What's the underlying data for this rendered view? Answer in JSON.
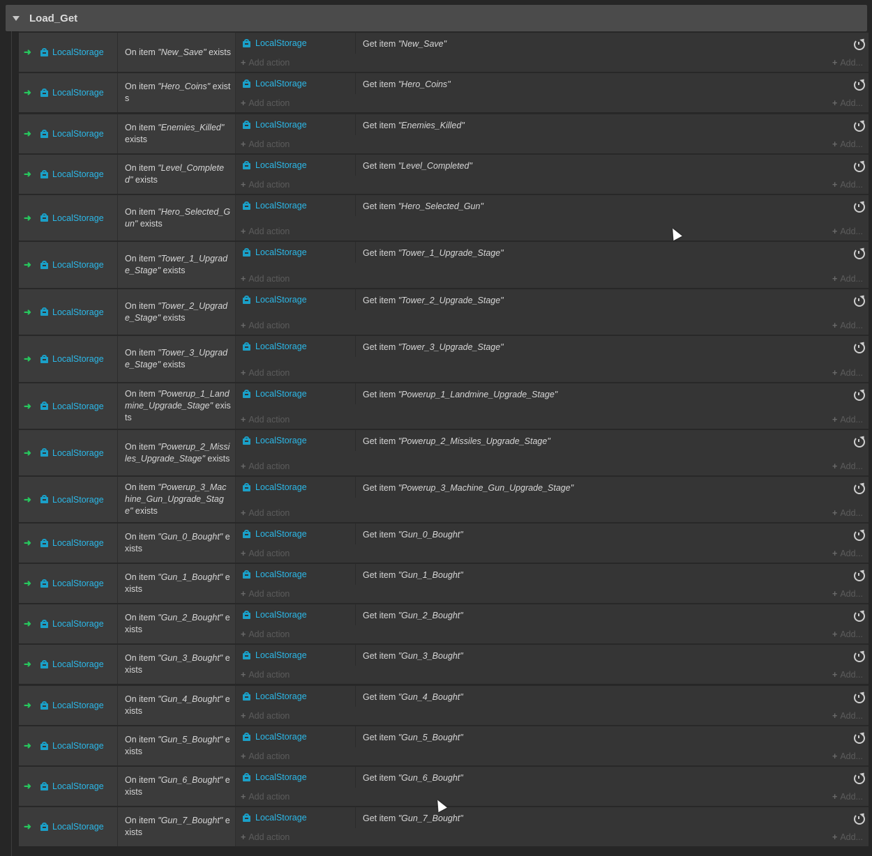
{
  "group": {
    "title": "Load_Get"
  },
  "common": {
    "object_name": "LocalStorage",
    "add_action": "Add action",
    "add_more": "Add...",
    "condition_prefix": "On item",
    "condition_suffix": "exists",
    "action_prefix": "Get item",
    "icons": {
      "trigger": "green-arrow-icon",
      "object": "local-storage-icon",
      "refresh": "refresh-icon",
      "expand": "triangle-down-icon"
    }
  },
  "rows": [
    {
      "item": "New_Save"
    },
    {
      "item": "Hero_Coins"
    },
    {
      "item": "Enemies_Killed"
    },
    {
      "item": "Level_Completed"
    },
    {
      "item": "Hero_Selected_Gun"
    },
    {
      "item": "Tower_1_Upgrade_Stage"
    },
    {
      "item": "Tower_2_Upgrade_Stage"
    },
    {
      "item": "Tower_3_Upgrade_Stage"
    },
    {
      "item": "Powerup_1_Landmine_Upgrade_Stage"
    },
    {
      "item": "Powerup_2_Missiles_Upgrade_Stage"
    },
    {
      "item": "Powerup_3_Machine_Gun_Upgrade_Stage"
    },
    {
      "item": "Gun_0_Bought"
    },
    {
      "item": "Gun_1_Bought"
    },
    {
      "item": "Gun_2_Bought"
    },
    {
      "item": "Gun_3_Bought"
    },
    {
      "item": "Gun_4_Bought"
    },
    {
      "item": "Gun_5_Bought"
    },
    {
      "item": "Gun_6_Bought"
    },
    {
      "item": "Gun_7_Bought"
    }
  ],
  "colors": {
    "accent": "#2bb8e8",
    "trigger": "#27c75d",
    "background": "#262626",
    "row": "#353535",
    "header": "#4b4b4b"
  }
}
